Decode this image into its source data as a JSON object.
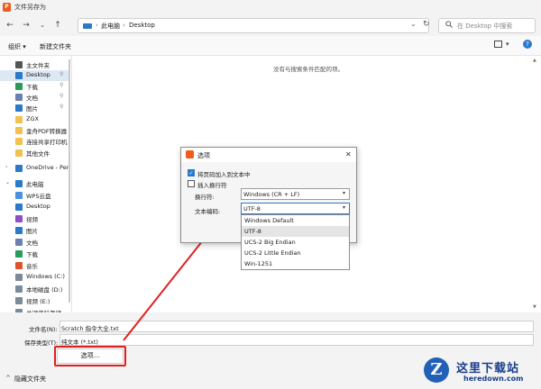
{
  "window": {
    "title": "文件另存为",
    "app_icon_letter": "P"
  },
  "nav": {
    "back": "←",
    "forward": "→",
    "dropdown": "⌄",
    "up": "↑",
    "breadcrumb": [
      "此电脑",
      "Desktop"
    ],
    "separator": "›",
    "refresh": "↻",
    "search_placeholder": "在 Desktop 中搜索"
  },
  "toolbar": {
    "organize": "组织 ▾",
    "new_folder": "新建文件夹",
    "view_dd": "▾",
    "help": "?"
  },
  "sidebar": {
    "items": [
      {
        "label": "主文件夹",
        "icon": "home-icon",
        "color": "#555555",
        "chev": ""
      },
      {
        "label": "Desktop",
        "icon": "desktop-icon",
        "color": "#2b79c9",
        "pin": "📌"
      },
      {
        "label": "下载",
        "icon": "download-icon",
        "color": "#2b9a5a",
        "pin": "📌"
      },
      {
        "label": "文档",
        "icon": "document-icon",
        "color": "#6b7fb0",
        "pin": "📌"
      },
      {
        "label": "图片",
        "icon": "pictures-icon",
        "color": "#2b79c9",
        "pin": "📌"
      },
      {
        "label": "ZGX",
        "icon": "folder-icon",
        "color": "#f2c14e"
      },
      {
        "label": "金舟PDF转换器",
        "icon": "folder-icon",
        "color": "#f2c14e"
      },
      {
        "label": "连接共享打印机",
        "icon": "folder-icon",
        "color": "#f2c14e"
      },
      {
        "label": "其他文件",
        "icon": "folder-icon",
        "color": "#f2c14e"
      },
      {
        "label": "OneDrive - Pers",
        "icon": "onedrive-icon",
        "color": "#2b79c9",
        "chev": "›"
      },
      {
        "label": "此电脑",
        "icon": "pc-icon",
        "color": "#2b79c9",
        "chev": "⌄"
      },
      {
        "label": "WPS云盘",
        "icon": "cloud-icon",
        "color": "#4a90e2"
      },
      {
        "label": "Desktop",
        "icon": "desktop-icon",
        "color": "#2b79c9"
      },
      {
        "label": "视频",
        "icon": "video-icon",
        "color": "#8a4fc9"
      },
      {
        "label": "图片",
        "icon": "pictures-icon",
        "color": "#2b79c9"
      },
      {
        "label": "文档",
        "icon": "document-icon",
        "color": "#6b7fb0"
      },
      {
        "label": "下载",
        "icon": "download-icon",
        "color": "#2b9a5a"
      },
      {
        "label": "音乐",
        "icon": "music-icon",
        "color": "#e0542a"
      },
      {
        "label": "Windows (C:)",
        "icon": "drive-icon",
        "color": "#7a8a99"
      },
      {
        "label": "本地磁盘 (D:)",
        "icon": "drive-icon",
        "color": "#7a8a99"
      },
      {
        "label": "视频 (E:)",
        "icon": "drive-icon",
        "color": "#7a8a99"
      },
      {
        "label": "关键资料存储",
        "icon": "drive-icon",
        "color": "#7a8a99"
      }
    ]
  },
  "main": {
    "empty_message": "没有与搜索条件匹配的项。"
  },
  "form": {
    "filename_label": "文件名(N):",
    "filename_value": "Scratch 指令大全.txt",
    "type_label": "保存类型(T):",
    "type_value": "纯文本 (*.txt)",
    "options_button": "选项..."
  },
  "footer": {
    "hide_folders": "隐藏文件夹",
    "chev": "^"
  },
  "dialog": {
    "title": "选项",
    "close": "✕",
    "checkbox1_label": "将页码加入到文本中",
    "checkbox1_checked": true,
    "checkbox2_label": "插入换行符",
    "checkbox2_checked": false,
    "line_ending_label": "换行符:",
    "line_ending_value": "Windows (CR + LF)",
    "encoding_label": "文本编码:",
    "encoding_value": "UTF-8",
    "encoding_options": [
      "Windows Default",
      "UTF-8",
      "UCS-2 Big Endian",
      "UCS-2 Little Endian",
      "Win-1251"
    ],
    "selected_index": 1
  },
  "watermark": {
    "logo_letter": "Z",
    "text": "这里下载站",
    "url": "heredown.com"
  },
  "colors": {
    "accent": "#2b79c9",
    "highlight": "#e02020"
  }
}
